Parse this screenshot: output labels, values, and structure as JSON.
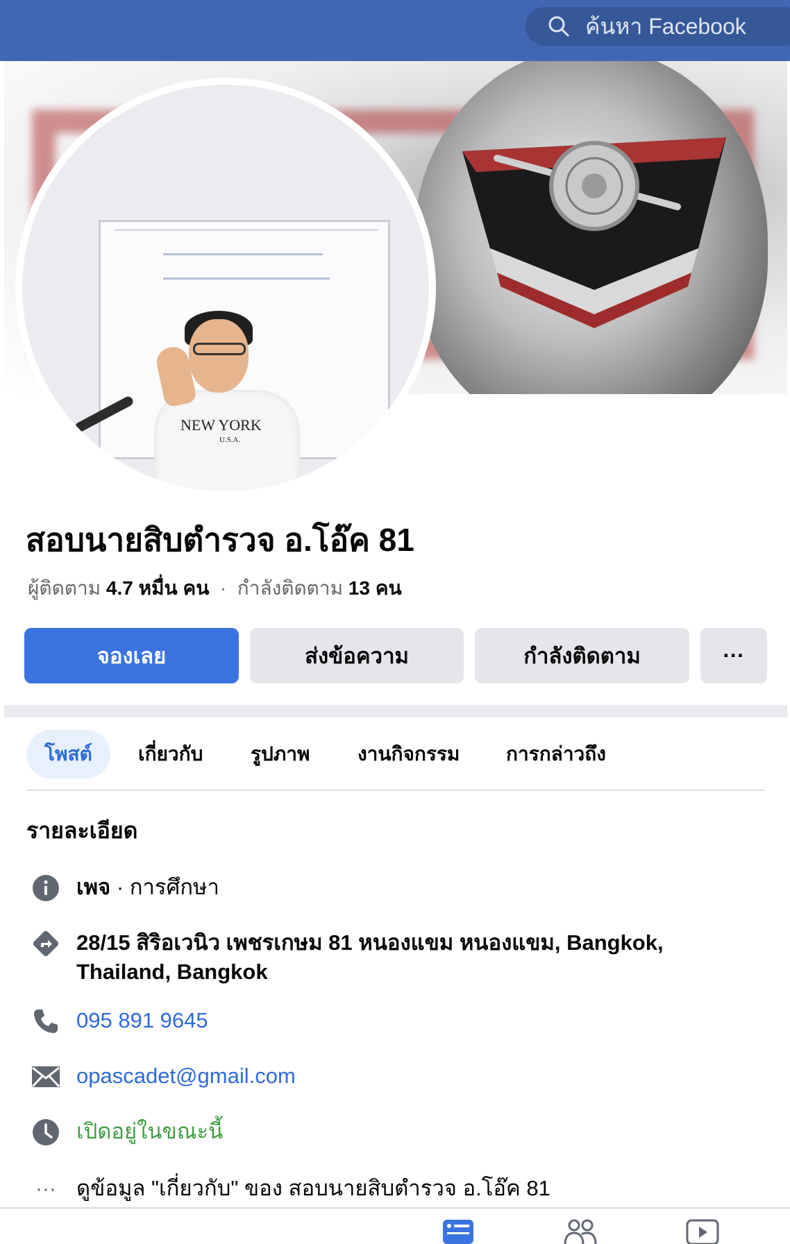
{
  "search": {
    "placeholder": "ค้นหา Facebook"
  },
  "page": {
    "name": "สอบนายสิบตำรวจ อ.โอ๊ค 81",
    "stats": {
      "followers_label": "ผู้ติดตาม",
      "followers_value": "4.7 หมื่น",
      "followers_unit": "คน",
      "separator": "·",
      "following_label": "กำลังติดตาม",
      "following_value": "13",
      "following_unit": "คน"
    },
    "avatar_shirt": {
      "line1": "NEW YORK",
      "line2": "U.S.A."
    }
  },
  "actions": {
    "book": "จองเลย",
    "message": "ส่งข้อความ",
    "following": "กำลังติดตาม",
    "more": "···"
  },
  "tabs": [
    "โพสต์",
    "เกี่ยวกับ",
    "รูปภาพ",
    "งานกิจกรรม",
    "การกล่าวถึง"
  ],
  "details": {
    "title": "รายละเอียด",
    "category_bold": "เพจ",
    "category_rest": " · การศึกษา",
    "address_line1": "28/15 สิริอเวนิว เพชรเกษม 81 หนองแขม หนองแขม, Bangkok,",
    "address_line2": "Thailand, Bangkok",
    "phone": "095 891 9645",
    "email": "opascadet@gmail.com",
    "hours": "เปิดอยู่ในขณะนี้",
    "see_about": "ดูข้อมูล \"เกี่ยวกับ\" ของ สอบนายสิบตำรวจ อ.โอ๊ค 81"
  },
  "colors": {
    "topbar": "#4267b2",
    "primary": "#3b74e0",
    "link": "#2d6bd8",
    "open": "#3f9e44"
  }
}
